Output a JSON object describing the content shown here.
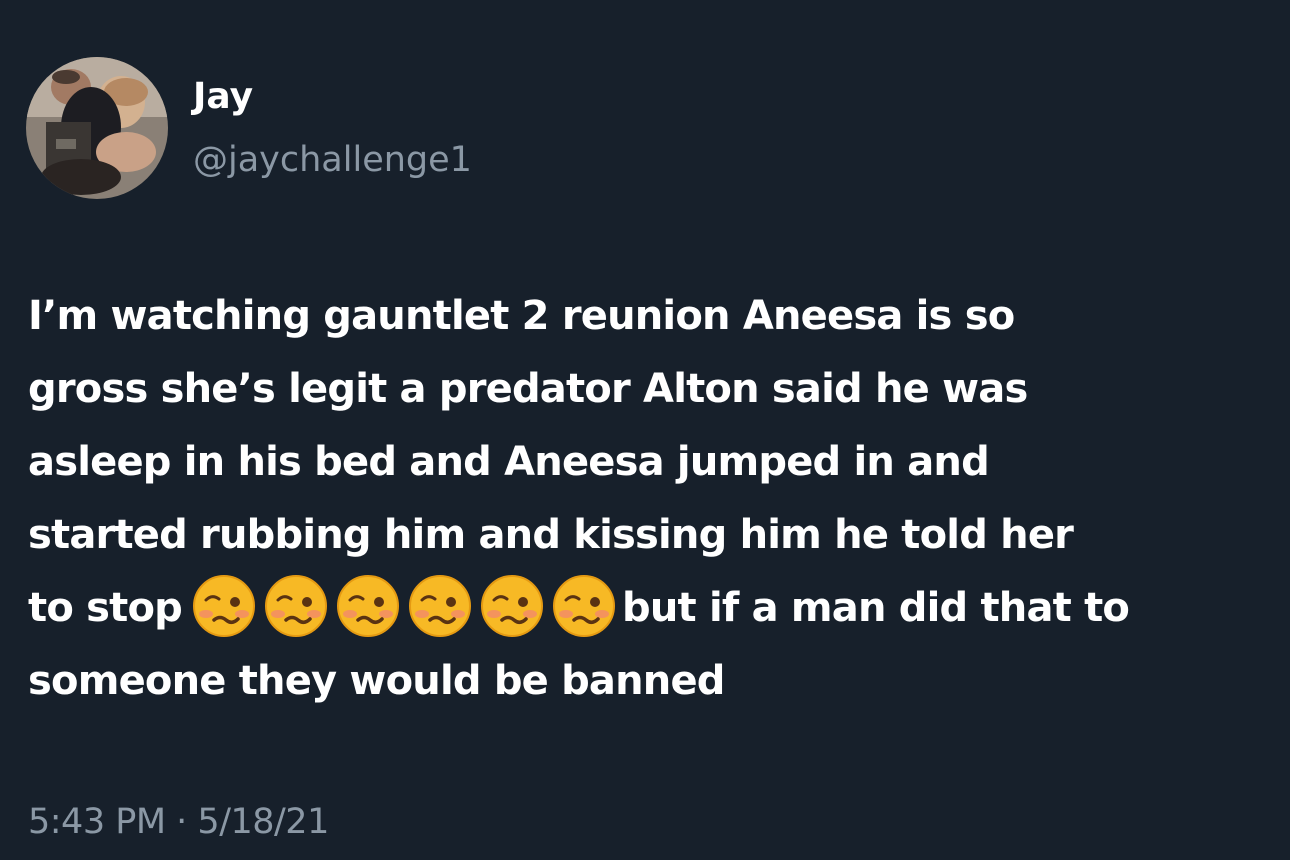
{
  "author": {
    "display_name": "Jay",
    "handle": "@jaychallenge1",
    "avatar_icon": "profile-photo"
  },
  "tweet": {
    "lines": [
      "I’m watching gauntlet 2 reunion Aneesa is so",
      "gross she’s legit a predator Alton said he was",
      "asleep in his bed and Aneesa jumped in and",
      "started rubbing him and kissing him he told her"
    ],
    "line5_before": "to stop",
    "emoji_icon": "woozy-face-emoji",
    "emoji_count": 6,
    "line5_after": "but if a man did that to",
    "line6": "someone they would be banned"
  },
  "meta": {
    "time": "5:43 PM",
    "separator": " · ",
    "date": "5/18/21"
  },
  "colors": {
    "background": "#17202b",
    "text_primary": "#ffffff",
    "text_secondary": "#8b98a5",
    "emoji": "#f7b925"
  }
}
